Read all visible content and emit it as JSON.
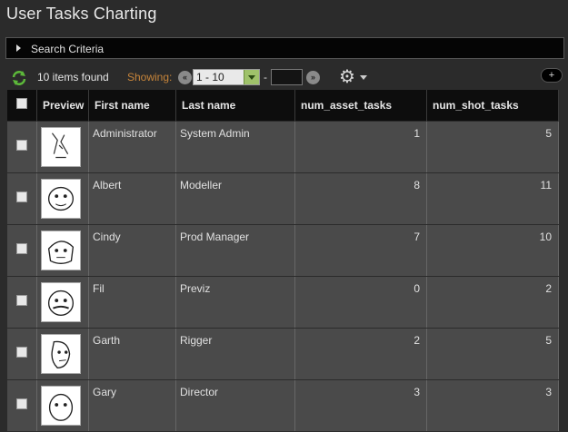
{
  "page": {
    "title": "User Tasks Charting"
  },
  "search": {
    "label": "Search Criteria"
  },
  "toolbar": {
    "items_found": "10 items found",
    "showing_label": "Showing:",
    "range_value": "1 - 10",
    "dash": "-",
    "page_value": "",
    "plus_label": "+"
  },
  "table": {
    "columns": [
      "Preview",
      "First name",
      "Last name",
      "num_asset_tasks",
      "num_shot_tasks"
    ],
    "rows": [
      {
        "first": "Administrator",
        "last": "System Admin",
        "asset": "1",
        "shot": "5"
      },
      {
        "first": "Albert",
        "last": "Modeller",
        "asset": "8",
        "shot": "11"
      },
      {
        "first": "Cindy",
        "last": "Prod Manager",
        "asset": "7",
        "shot": "10"
      },
      {
        "first": "Fil",
        "last": "Previz",
        "asset": "0",
        "shot": "2"
      },
      {
        "first": "Garth",
        "last": "Rigger",
        "asset": "2",
        "shot": "5"
      },
      {
        "first": "Gary",
        "last": "Director",
        "asset": "3",
        "shot": "3"
      }
    ]
  }
}
